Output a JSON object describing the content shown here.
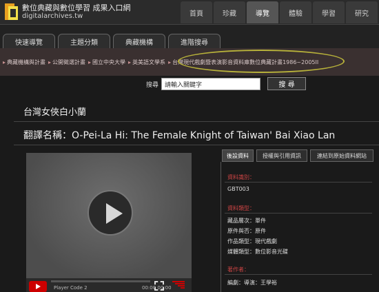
{
  "site": {
    "title": "數位典藏與數位學習 成果入口網",
    "domain": "digitalarchives.tw"
  },
  "nav": [
    "首頁",
    "珍藏",
    "導覽",
    "體驗",
    "學習",
    "研究"
  ],
  "subtabs": [
    "快速導覽",
    "主題分類",
    "典藏機構",
    "進階搜尋"
  ],
  "breadcrumb": [
    "典藏機構與計畫",
    "公開徵選計畫",
    "國立中央大學",
    "英美語文學系",
    "台灣現代戲劇暨表演影音資料庫數位典藏計畫1986~2005II"
  ],
  "search": {
    "label": "搜尋",
    "placeholder": "請輸入關鍵字",
    "button": "搜 尋"
  },
  "page": {
    "title": "台灣女俠白小蘭",
    "translated": "翻譯名稱：O-Pei-La Hi: The Female Knight of Taiwan' Bai Xiao Lan"
  },
  "player": {
    "text": "Player Code 2",
    "time": "00:00 00:00",
    "progress": 0.0
  },
  "tabs": [
    "後設資料",
    "授權與引用資訊",
    "連結到原始資料網站"
  ],
  "metadata": {
    "category_label": "資料識別：",
    "category_value": "GBT003",
    "type_label": "資料類型：",
    "type_rows": [
      "藏品層次：單件",
      "原件與否：原件",
      "作品類型：現代戲劇",
      "媒體類型：數位影音光碟"
    ],
    "author_label": "著作者：",
    "author_value": "編劇：導演：王學裕"
  },
  "colors": {
    "accent": "#cc0000",
    "highlight": "#b8b23a"
  }
}
